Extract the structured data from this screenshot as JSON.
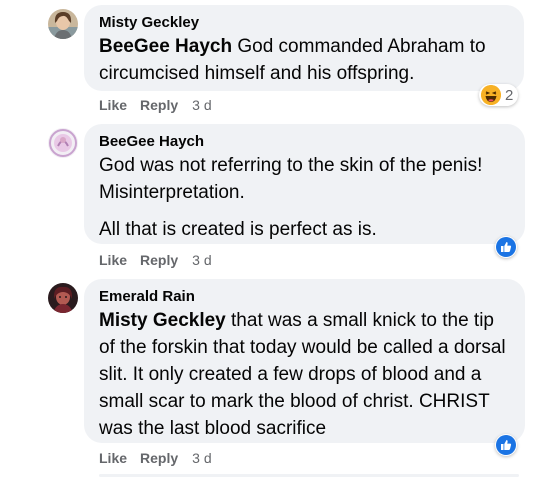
{
  "comments": [
    {
      "author": "Misty Geckley",
      "tag": "BeeGee Haych",
      "text": "God commanded Abraham to circumcised himself and his offspring.",
      "actions": {
        "like": "Like",
        "reply": "Reply",
        "time": "3 d"
      },
      "reaction": {
        "icon": "haha-icon",
        "count": "2"
      }
    },
    {
      "author": "BeeGee Haych",
      "paragraphs": [
        "God was not referring to the skin of the penis! Misinterpretation.",
        "All that is created is perfect as is."
      ],
      "actions": {
        "like": "Like",
        "reply": "Reply",
        "time": "3 d"
      },
      "reaction": {
        "icon": "like-icon"
      }
    },
    {
      "author": "Emerald Rain",
      "tag": "Misty Geckley",
      "text": "that was a small knick to the tip of the forskin that today would be called a dorsal slit. It only created a few drops of blood and a small scar to mark the blood of christ. CHRIST was the last blood sacrifice",
      "actions": {
        "like": "Like",
        "reply": "Reply",
        "time": "3 d"
      },
      "reaction": {
        "icon": "like-icon"
      }
    }
  ],
  "colors": {
    "bubble": "#f0f2f5",
    "meta": "#65676b",
    "like_blue": "#1b74e4",
    "haha_yellow": "#f7b125"
  }
}
